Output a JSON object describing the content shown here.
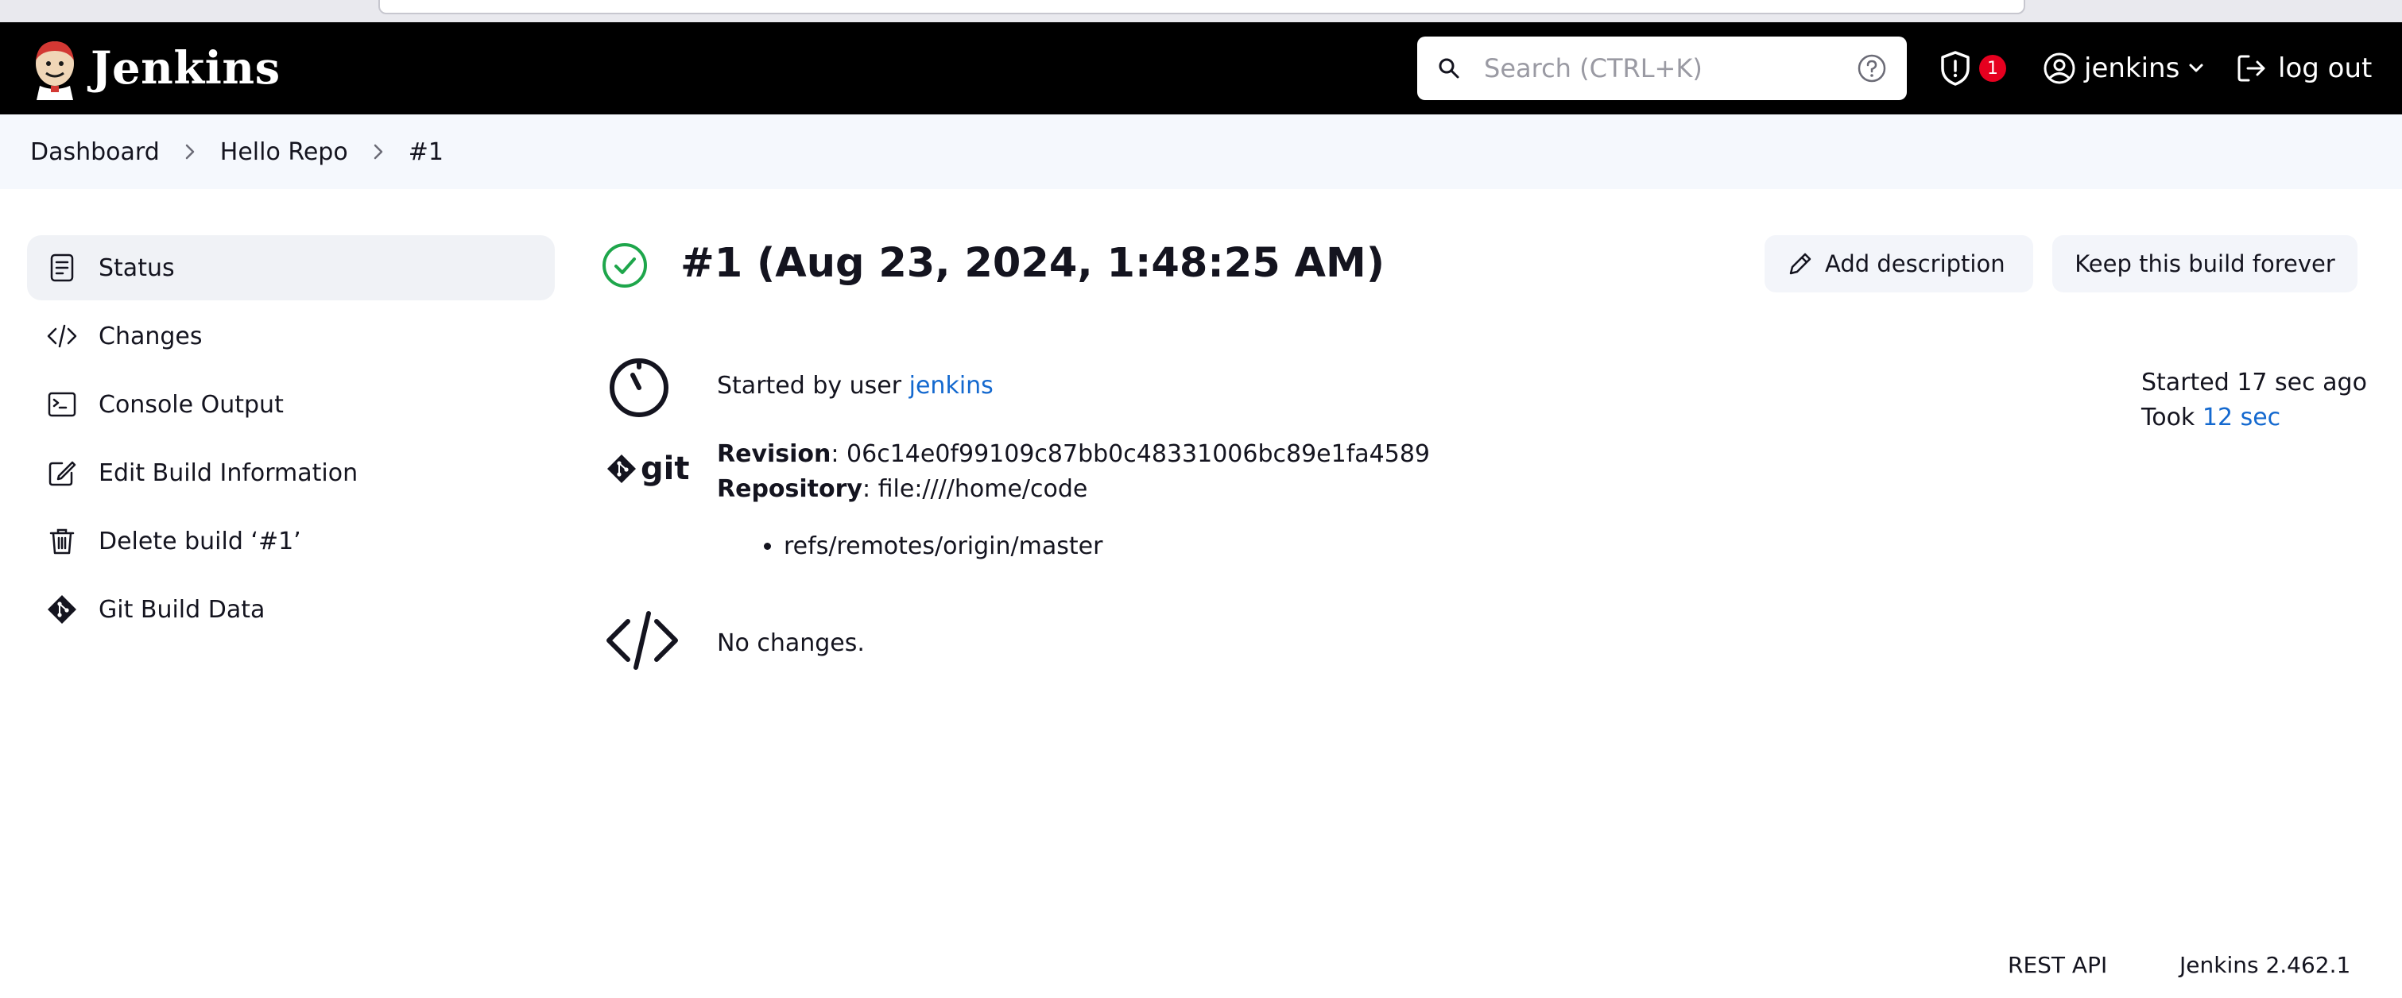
{
  "header": {
    "app_name": "Jenkins",
    "search_placeholder": "Search (CTRL+K)",
    "security_badge_count": "1",
    "user_name": "jenkins",
    "logout_label": "log out"
  },
  "breadcrumb": {
    "items": [
      "Dashboard",
      "Hello Repo",
      "#1"
    ]
  },
  "sidebar": {
    "items": [
      {
        "label": "Status",
        "icon": "document-icon",
        "active": true
      },
      {
        "label": "Changes",
        "icon": "code-icon"
      },
      {
        "label": "Console Output",
        "icon": "terminal-icon"
      },
      {
        "label": "Edit Build Information",
        "icon": "edit-icon"
      },
      {
        "label": "Delete build ‘#1’",
        "icon": "trash-icon"
      },
      {
        "label": "Git Build Data",
        "icon": "git-icon"
      }
    ]
  },
  "build": {
    "title": "#1 (Aug 23, 2024, 1:48:25 AM)",
    "status": "success",
    "add_description_label": "Add description",
    "keep_forever_label": "Keep this build forever",
    "started_by_prefix": "Started by user ",
    "started_by_user": "jenkins",
    "started_ago": "Started 17 sec ago",
    "took_prefix": "Took ",
    "took_value": "12 sec",
    "git_label": "git",
    "revision_label": "Revision",
    "revision_value": ": 06c14e0f99109c87bb0c48331006bc89e1fa4589",
    "repository_label": "Repository",
    "repository_value": ": file:////home/code",
    "branches": [
      "refs/remotes/origin/master"
    ],
    "changes_text": "No changes."
  },
  "footer": {
    "rest_api_label": "REST API",
    "version_label": "Jenkins 2.462.1"
  },
  "colors": {
    "header_bg": "#000000",
    "link": "#1469cf",
    "success": "#1ea64b",
    "badge": "#e6001f"
  }
}
